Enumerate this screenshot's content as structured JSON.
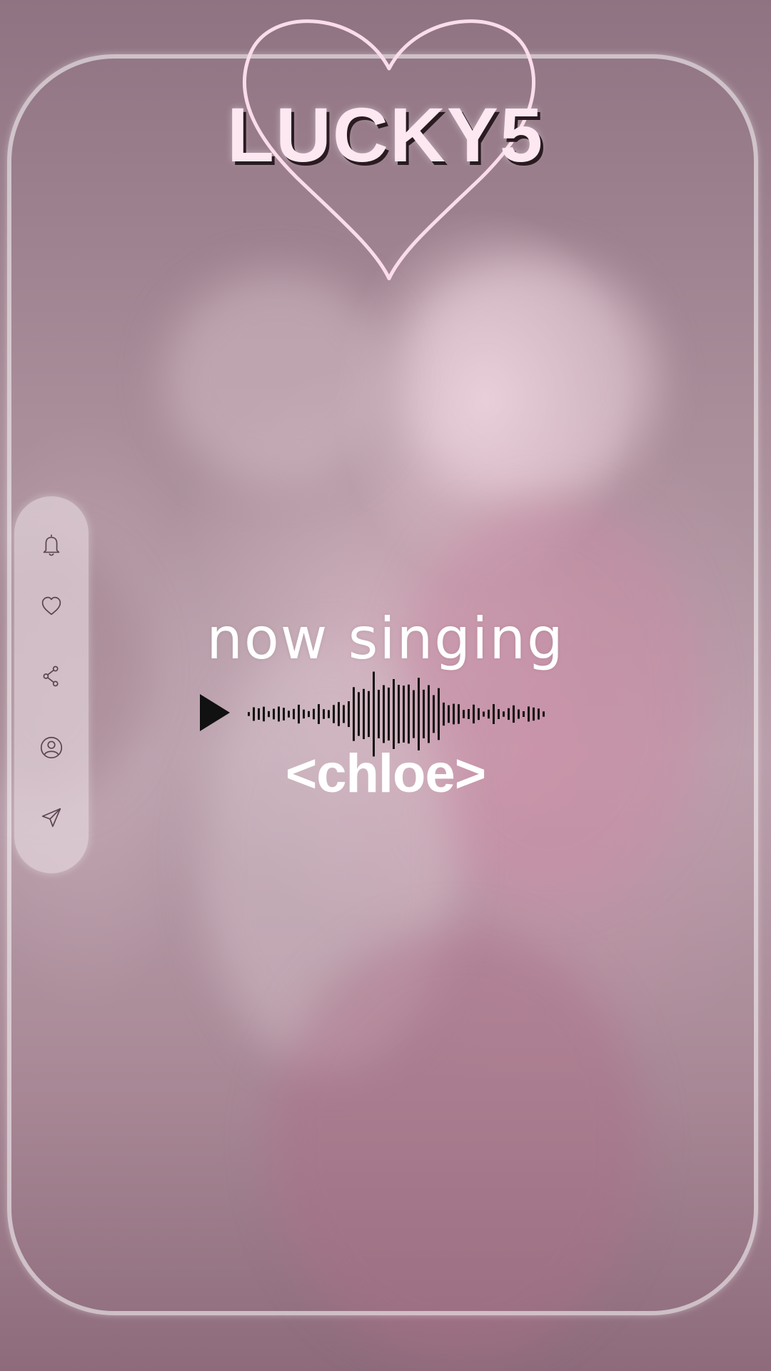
{
  "brand": {
    "name": "LUCKY5",
    "heart_color": "#fbdcea"
  },
  "sidebar": {
    "items": [
      {
        "icon": "bell-icon"
      },
      {
        "icon": "heart-icon"
      },
      {
        "icon": "share-icon"
      },
      {
        "icon": "profile-icon"
      },
      {
        "icon": "send-icon"
      }
    ]
  },
  "player": {
    "status_label": "now singing",
    "song_title": "<chloe>",
    "play_icon": "play-icon",
    "waveform_icon": "waveform-icon",
    "text_color": "#ffffff",
    "accent_color": "#111111"
  },
  "frame": {
    "border_color": "#ffffff"
  }
}
